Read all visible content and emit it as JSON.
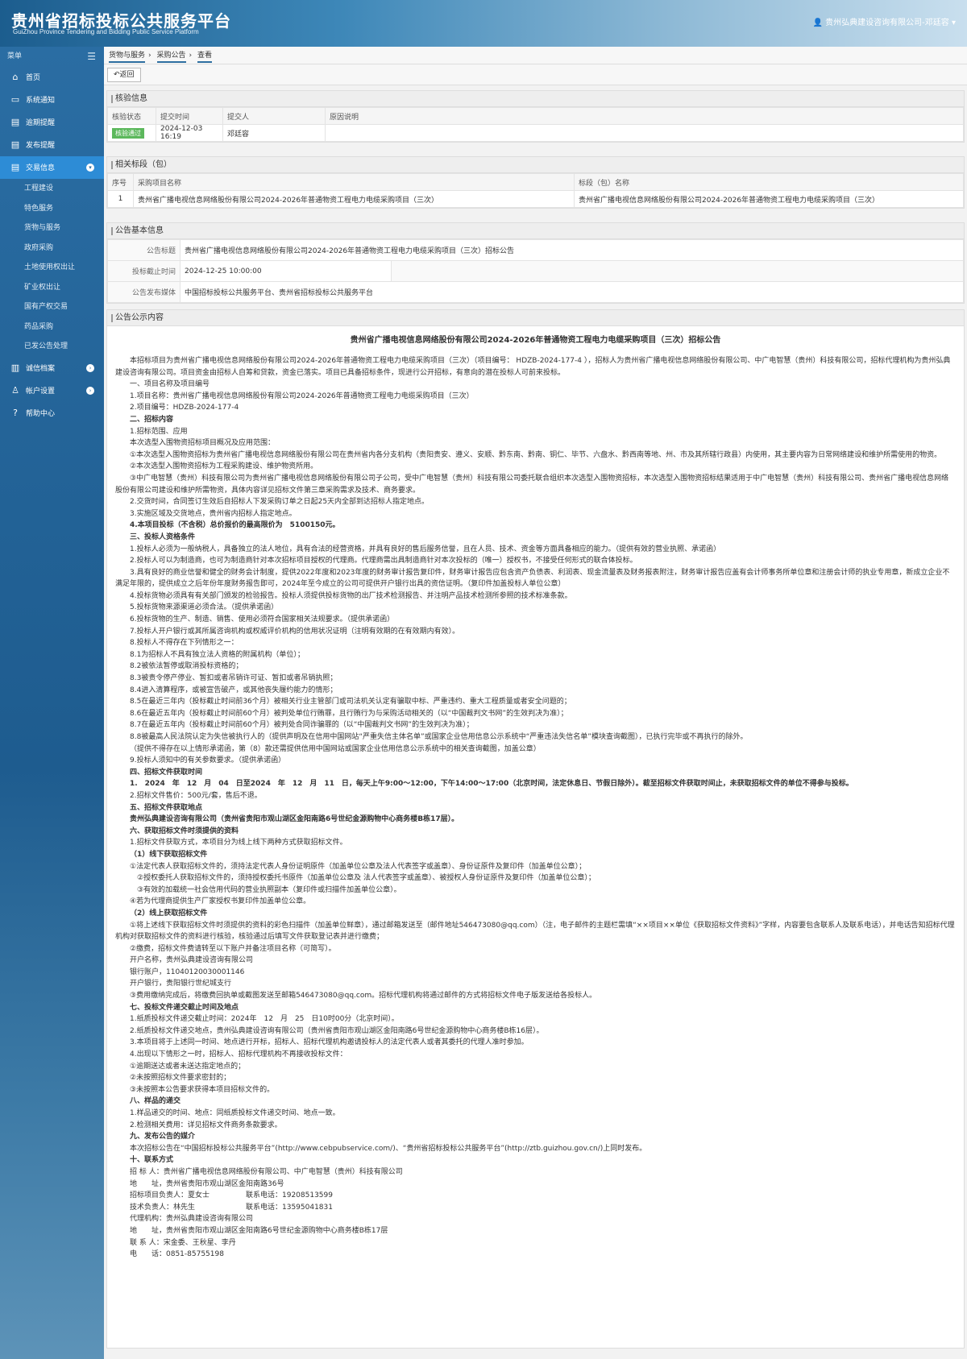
{
  "header": {
    "title": "贵州省招标投标公共服务平台",
    "subtitle": "GuiZhou Province Tendering and Bidding Public Service Platform",
    "user": "贵州弘典建设咨询有限公司-邓廷容"
  },
  "sidebar": {
    "menu_label": "菜单",
    "items": [
      {
        "label": "首页",
        "icon": "home-icon"
      },
      {
        "label": "系统通知",
        "icon": "monitor-icon"
      },
      {
        "label": "逾期提醒",
        "icon": "inbox-icon"
      },
      {
        "label": "发布提醒",
        "icon": "inbox-icon"
      },
      {
        "label": "交易信息",
        "icon": "inbox-icon"
      }
    ],
    "subitems": [
      "工程建设",
      "特色服务",
      "货物与服务",
      "政府采购",
      "土地使用权出让",
      "矿业权出让",
      "国有产权交易",
      "药品采购",
      "已发公告处理"
    ],
    "items2": [
      {
        "label": "诚信档案",
        "icon": "book-icon"
      },
      {
        "label": "帐户设置",
        "icon": "user-icon"
      },
      {
        "label": "帮助中心",
        "icon": "help-icon"
      }
    ]
  },
  "breadcrumb": [
    "货物与服务",
    "采购公告",
    "查看"
  ],
  "back_label": "返回",
  "check": {
    "title": "核验信息",
    "headers": [
      "核验状态",
      "提交时间",
      "提交人",
      "原因说明"
    ],
    "status": "核验通过",
    "time": "2024-12-03 16:19",
    "person": "邓廷容",
    "reason": ""
  },
  "lots": {
    "title": "相关标段（包）",
    "headers": [
      "序号",
      "采购项目名称",
      "标段（包）名称"
    ],
    "rows": [
      {
        "no": "1",
        "project": "贵州省广播电视信息网络股份有限公司2024-2026年普通物资工程电力电缆采购项目（三次）",
        "lot": "贵州省广播电视信息网络股份有限公司2024-2026年普通物资工程电力电缆采购项目（三次）"
      }
    ]
  },
  "basic": {
    "title": "公告基本信息",
    "name_label": "公告标题",
    "name": "贵州省广播电视信息网络股份有限公司2024-2026年普通物资工程电力电缆采购项目（三次）招标公告",
    "deadline_label": "投标截止时间",
    "deadline": "2024-12-25 10:00:00",
    "media_label": "公告发布媒体",
    "media": "中国招标投标公共服务平台、贵州省招标投标公共服务平台"
  },
  "content": {
    "title": "公告公示内容",
    "doc_title": "贵州省广播电视信息网络股份有限公司2024-2026年普通物资工程电力电缆采购项目（三次）招标公告",
    "lines": [
      {
        "t": "本招标项目为贵州省广播电视信息网络股份有限公司2024-2026年普通物资工程电力电缆采购项目（三次）（项目编号： HDZB-2024-177-4 ），招标人为贵州省广播电视信息网络股份有限公司、中广电智慧（贵州）科技有限公司，招标代理机构为贵州弘典建设咨询有限公司。项目资金由招标人自筹和贷款，资金已落实。项目已具备招标条件，现进行公开招标，有意向的潜在投标人可前来投标。",
        "s": "ind"
      },
      {
        "t": "一、项目名称及项目编号",
        "s": "ind"
      },
      {
        "t": "1.项目名称：贵州省广播电视信息网络股份有限公司2024-2026年普通物资工程电力电缆采购项目（三次）",
        "s": "ind"
      },
      {
        "t": "2.项目编号：HDZB-2024-177-4",
        "s": "ind"
      },
      {
        "t": "二、招标内容",
        "s": "ind b"
      },
      {
        "t": "1.招标范围、应用",
        "s": "ind"
      },
      {
        "t": "本次选型入围物资招标项目概况及应用范围：",
        "s": "ind"
      },
      {
        "t": "①本次选型入围物资招标为贵州省广播电视信息网络股份有限公司在贵州省内各分支机构（贵阳贵安、遵义、安顺、黔东南、黔南、铜仁、毕节、六盘水、黔西南等地、州、市及其所辖行政县）内使用，其主要内容为日常网络建设和维护所需使用的物资。",
        "s": "ind"
      },
      {
        "t": "②本次选型入围物资招标为工程采购建设、维护物资所用。",
        "s": "ind"
      },
      {
        "t": "③中广电智慧（贵州）科技有限公司为贵州省广播电视信息网络股份有限公司子公司，受中广电智慧（贵州）科技有限公司委托联合组织本次选型入围物资招标，本次选型入围物资招标结果适用于中广电智慧（贵州）科技有限公司、贵州省广播电视信息网络股份有限公司建设和维护所需物资，具体内容详见招标文件第三章采购需求及技术、商务要求。",
        "s": "ind"
      },
      {
        "t": "2.交货时间，合同签订生效后自招标人下发采购订单之日起25天内全部到达招标人指定地点。",
        "s": "ind"
      },
      {
        "t": "3.实施区域及交货地点，贵州省内招标人指定地点。",
        "s": "ind"
      },
      {
        "t": "4.本项目投标（不含税）总价报价的最高限价为　5100150元。",
        "s": "ind b"
      },
      {
        "t": "三、投标人资格条件",
        "s": "ind b"
      },
      {
        "t": "1.投标人必须为一般纳税人，具备独立的法人地位，具有合法的经营资格，并具有良好的售后服务信誉，且在人员、技术、资金等方面具备相应的能力。（提供有效的营业执照、承诺函）",
        "s": "ind"
      },
      {
        "t": "2.投标人可以为制造商，也可为制造商针对本次招标项目授权的代理商。代理商需出具制造商针对本次投标的（唯一）授权书，不接受任何形式的联合体投标。",
        "s": "ind"
      },
      {
        "t": "3.具有良好的商业信誉和健全的财务会计制度，提供2022年度和2023年度的财务审计报告复印件，财务审计报告应包含资产负债表、利润表、现金流量表及财务报表附注，财务审计报告应盖有会计师事务所单位章和注册会计师的执业专用章，新成立企业不满足年限的，提供成立之后年份年度财务报告即可，2024年至今成立的公司可提供开户银行出具的资信证明。（复印件加盖投标人单位公章）",
        "s": "ind"
      },
      {
        "t": "4.投标货物必须具有有关部门颁发的检验报告。投标人须提供投标货物的出厂技术检测报告、并注明产品技术检测所参照的技术标准条款。",
        "s": "ind"
      },
      {
        "t": "5.投标货物来源渠道必须合法。（提供承诺函）",
        "s": "ind"
      },
      {
        "t": "6.投标货物的生产、制造、销售、使用必须符合国家相关法规要求。（提供承诺函）",
        "s": "ind"
      },
      {
        "t": "7.投标人开户银行或其所属咨询机构或权威评价机构的信用状况证明（注明有效期的在有效期内有效）。",
        "s": "ind"
      },
      {
        "t": "8.投标人不得存在下列情形之一：",
        "s": "ind"
      },
      {
        "t": "8.1为招标人不具有独立法人资格的附属机构（单位）；",
        "s": "ind"
      },
      {
        "t": "8.2被依法暂停或取消投标资格的；",
        "s": "ind"
      },
      {
        "t": "8.3被责令停产停业、暂扣或者吊销许可证、暂扣或者吊销执照；",
        "s": "ind"
      },
      {
        "t": "8.4进入清算程序，或被宣告破产，或其他丧失履约能力的情形；",
        "s": "ind"
      },
      {
        "t": "8.5在最近三年内（投标截止时间前36个月）被相关行业主管部门或司法机关认定有骗取中标、严重违约、重大工程质量或者安全问题的；",
        "s": "ind"
      },
      {
        "t": "8.6在最近五年内（投标截止时间前60个月）被判处单位行贿罪，且行贿行为与采购活动相关的（以“中国裁判文书网”的生效判决为准）；",
        "s": "ind"
      },
      {
        "t": "8.7在最近五年内（投标截止时间前60个月）被判处合同诈骗罪的（以“中国裁判文书网”的生效判决为准）；",
        "s": "ind"
      },
      {
        "t": "8.8被最高人民法院认定为失信被执行人的（提供声明及在信用中国网站“严重失信主体名单”或国家企业信用信息公示系统中“严重违法失信名单”模块查询截图），已执行完毕或不再执行的除外。",
        "s": "ind"
      },
      {
        "t": "（提供不得存在以上情形承诺函，第（8）款还需提供信用中国网站或国家企业信用信息公示系统中的相关查询截图，加盖公章）",
        "s": "ind"
      },
      {
        "t": "9.投标人须知中的有关参数要求。（提供承诺函）",
        "s": "ind"
      },
      {
        "t": "四、招标文件获取时间",
        "s": "ind b"
      },
      {
        "t": "1.　2024　年　12　月　04　日至2024　年　12　月　11　日，每天上午9:00～12:00，下午14:00～17:00（北京时间，法定休息日、节假日除外）。截至招标文件获取时间止，未获取招标文件的单位不得参与投标。",
        "s": "ind b"
      },
      {
        "t": "2.招标文件售价：500元/套，售后不退。",
        "s": "ind"
      },
      {
        "t": "五、招标文件获取地点",
        "s": "ind b"
      },
      {
        "t": "贵州弘典建设咨询有限公司（贵州省贵阳市观山湖区金阳南路6号世纪金源购物中心商务楼B栋17层）。",
        "s": "ind b"
      },
      {
        "t": "六、获取招标文件时须提供的资料",
        "s": "ind b"
      },
      {
        "t": "1.招标文件获取方式，本项目分为线上线下两种方式获取招标文件。",
        "s": "ind"
      },
      {
        "t": "（1）线下获取招标文件",
        "s": "ind b"
      },
      {
        "t": "①法定代表人获取招标文件的，须持法定代表人身份证明原件（加盖单位公章及法人代表签字或盖章）、身份证原件及复印件（加盖单位公章）；",
        "s": "ind"
      },
      {
        "t": "　②授权委托人获取招标文件的，须持授权委托书原件（加盖单位公章及 法人代表签字或盖章）、被授权人身份证原件及复印件（加盖单位公章）；",
        "s": "ind"
      },
      {
        "t": "　③有效的加载统一社会信用代码的营业执照副本（复印件或扫描件加盖单位公章）。",
        "s": "ind"
      },
      {
        "t": "④若为代理商提供生产厂家授权书复印件加盖单位公章。",
        "s": "ind"
      },
      {
        "t": "（2）线上获取招标文件",
        "s": "ind b"
      },
      {
        "t": "①将上述线下获取招标文件时须提供的资料的彩色扫描件（加盖单位鲜章），通过邮箱发送至（邮件地址546473080@qq.com）（注，电子邮件的主题栏需填“××项目××单位《获取招标文件资料》”字样，内容要包含联系人及联系电话），并电话告知招标代理机构对获取招标文件的资料进行核验，核验通过后填写文件获取登记表并进行缴费；",
        "s": "ind"
      },
      {
        "t": "②缴费，招标文件费请转至以下账户并备注项目名称（可简写）。",
        "s": "ind"
      },
      {
        "t": "开户名称，贵州弘典建设咨询有限公司",
        "s": "ind"
      },
      {
        "t": "银行账户，11040120030001146",
        "s": "ind"
      },
      {
        "t": "开户银行，贵阳银行世纪城支行",
        "s": "ind"
      },
      {
        "t": "③费用缴纳完成后，将缴费回执单或截图发送至邮箱546473080@qq.com。招标代理机构将通过邮件的方式将招标文件电子版发送给各投标人。",
        "s": "ind"
      },
      {
        "t": "七、投标文件递交截止时间及地点",
        "s": "ind b"
      },
      {
        "t": "1.纸质投标文件递交截止时间：2024年　12　月　25　日10时00分（北京时间）。",
        "s": "ind"
      },
      {
        "t": "2.纸质投标文件递交地点，贵州弘典建设咨询有限公司（贵州省贵阳市观山湖区金阳南路6号世纪金源购物中心商务楼B栋16层）。",
        "s": "ind"
      },
      {
        "t": "3.本项目将于上述同一时间、地点进行开标，招标人、招标代理机构邀请投标人的法定代表人或者其委托的代理人准时参加。",
        "s": "ind"
      },
      {
        "t": "4.出现以下情形之一时，招标人、招标代理机构不再接收投标文件：",
        "s": "ind"
      },
      {
        "t": "①逾期送达或者未送达指定地点的；",
        "s": "ind"
      },
      {
        "t": "②未按照招标文件要求密封的；",
        "s": "ind"
      },
      {
        "t": "③未按照本公告要求获得本项目招标文件的。",
        "s": "ind"
      },
      {
        "t": "八、样品的递交",
        "s": "ind b"
      },
      {
        "t": "1.样品递交的时间、地点：同纸质投标文件递交时间、地点一致。",
        "s": "ind"
      },
      {
        "t": "2.检测相关费用：详见招标文件商务条款要求。",
        "s": "ind"
      },
      {
        "t": "九、发布公告的媒介",
        "s": "ind b"
      },
      {
        "t": "本次招标公告在“中国招标投标公共服务平台”(http://www.cebpubservice.com/)、“贵州省招标投标公共服务平台”(http://ztb.guizhou.gov.cn/)上同时发布。",
        "s": "ind"
      },
      {
        "t": "十、联系方式",
        "s": "ind b"
      },
      {
        "t": "招 标 人：贵州省广播电视信息网络股份有限公司、中广电智慧（贵州）科技有限公司",
        "s": "ind"
      },
      {
        "t": "地　　址，贵州省贵阳市观山湖区金阳南路36号",
        "s": "ind"
      },
      {
        "t": "招标项目负责人：夏女士　　　　　联系电话：19208513599",
        "s": "ind"
      },
      {
        "t": "技术负责人：林先生　　　　　　　联系电话：13595041831",
        "s": "ind"
      },
      {
        "t": "代理机构：贵州弘典建设咨询有限公司",
        "s": "ind"
      },
      {
        "t": "地　　址，贵州省贵阳市观山湖区金阳南路6号世纪金源购物中心商务楼B栋17层",
        "s": "ind"
      },
      {
        "t": "联 系 人：宋金委、王秋星、李丹",
        "s": "ind"
      },
      {
        "t": "电　　话：0851-85755198",
        "s": "ind"
      }
    ]
  }
}
